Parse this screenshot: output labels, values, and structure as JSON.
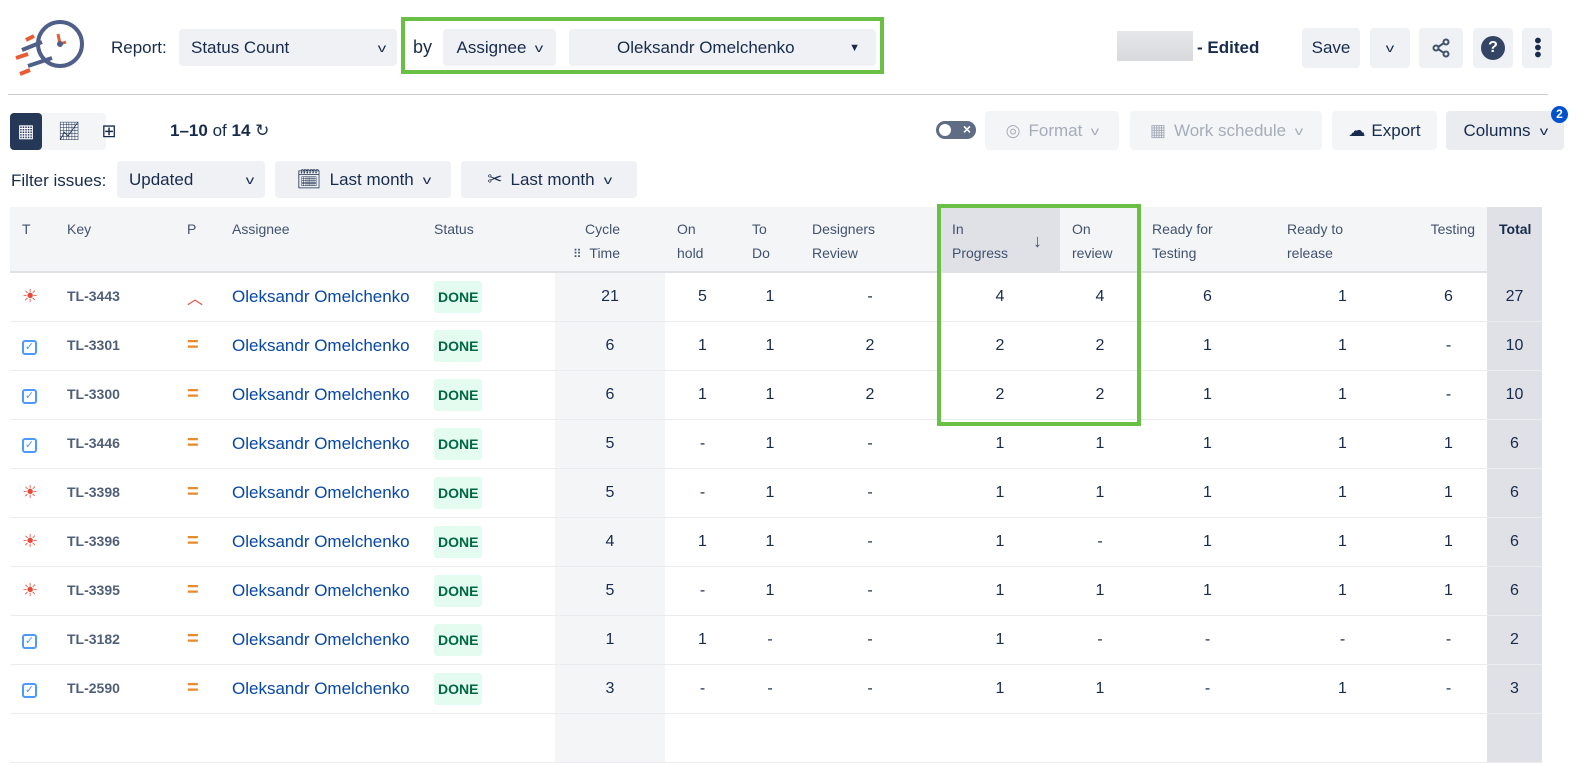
{
  "header": {
    "report_label": "Report:",
    "report_value": "Status Count",
    "by_label": "by",
    "group_by": "Assignee",
    "assignee_filter": "Oleksandr Omelchenko",
    "edited_label": "- Edited",
    "save_label": "Save"
  },
  "toolbar": {
    "pagination": {
      "range": "1–10",
      "of": "of",
      "total": "14"
    },
    "format_label": "Format",
    "work_schedule_label": "Work schedule",
    "export_label": "Export",
    "columns_label": "Columns",
    "columns_badge": "2"
  },
  "filters": {
    "label": "Filter issues:",
    "field": "Updated",
    "period1": "Last month",
    "period2": "Last month"
  },
  "table": {
    "columns": [
      "T",
      "Key",
      "P",
      "Assignee",
      "Status",
      "Cycle Time",
      "On hold",
      "To Do",
      "Designers Review",
      "In Progress",
      "On review",
      "Ready for Testing",
      "Ready to release",
      "Testing",
      "Total"
    ],
    "rows": [
      {
        "type": "bug",
        "key": "TL-3443",
        "priority": "high",
        "assignee": "Oleksandr Omelchenko",
        "status": "DONE",
        "vals": [
          "21",
          "5",
          "1",
          "-",
          "4",
          "4",
          "6",
          "1",
          "6",
          "27"
        ]
      },
      {
        "type": "task",
        "key": "TL-3301",
        "priority": "medium",
        "assignee": "Oleksandr Omelchenko",
        "status": "DONE",
        "vals": [
          "6",
          "1",
          "1",
          "2",
          "2",
          "2",
          "1",
          "1",
          "-",
          "10"
        ]
      },
      {
        "type": "task",
        "key": "TL-3300",
        "priority": "medium",
        "assignee": "Oleksandr Omelchenko",
        "status": "DONE",
        "vals": [
          "6",
          "1",
          "1",
          "2",
          "2",
          "2",
          "1",
          "1",
          "-",
          "10"
        ]
      },
      {
        "type": "task",
        "key": "TL-3446",
        "priority": "medium",
        "assignee": "Oleksandr Omelchenko",
        "status": "DONE",
        "vals": [
          "5",
          "-",
          "1",
          "-",
          "1",
          "1",
          "1",
          "1",
          "1",
          "6"
        ]
      },
      {
        "type": "bug",
        "key": "TL-3398",
        "priority": "medium",
        "assignee": "Oleksandr Omelchenko",
        "status": "DONE",
        "vals": [
          "5",
          "-",
          "1",
          "-",
          "1",
          "1",
          "1",
          "1",
          "1",
          "6"
        ]
      },
      {
        "type": "bug",
        "key": "TL-3396",
        "priority": "medium",
        "assignee": "Oleksandr Omelchenko",
        "status": "DONE",
        "vals": [
          "4",
          "1",
          "1",
          "-",
          "1",
          "-",
          "1",
          "1",
          "1",
          "6"
        ]
      },
      {
        "type": "bug",
        "key": "TL-3395",
        "priority": "medium",
        "assignee": "Oleksandr Omelchenko",
        "status": "DONE",
        "vals": [
          "5",
          "-",
          "1",
          "-",
          "1",
          "1",
          "1",
          "1",
          "1",
          "6"
        ]
      },
      {
        "type": "task",
        "key": "TL-3182",
        "priority": "medium",
        "assignee": "Oleksandr Omelchenko",
        "status": "DONE",
        "vals": [
          "1",
          "1",
          "-",
          "-",
          "1",
          "-",
          "-",
          "-",
          "-",
          "2"
        ]
      },
      {
        "type": "task",
        "key": "TL-2590",
        "priority": "medium",
        "assignee": "Oleksandr Omelchenko",
        "status": "DONE",
        "vals": [
          "3",
          "-",
          "-",
          "-",
          "1",
          "1",
          "-",
          "1",
          "-",
          "3"
        ]
      }
    ]
  },
  "colors": {
    "highlight": "#6abf45",
    "link": "#0747a6",
    "done_bg": "#e3fcef",
    "done_text": "#006644"
  }
}
